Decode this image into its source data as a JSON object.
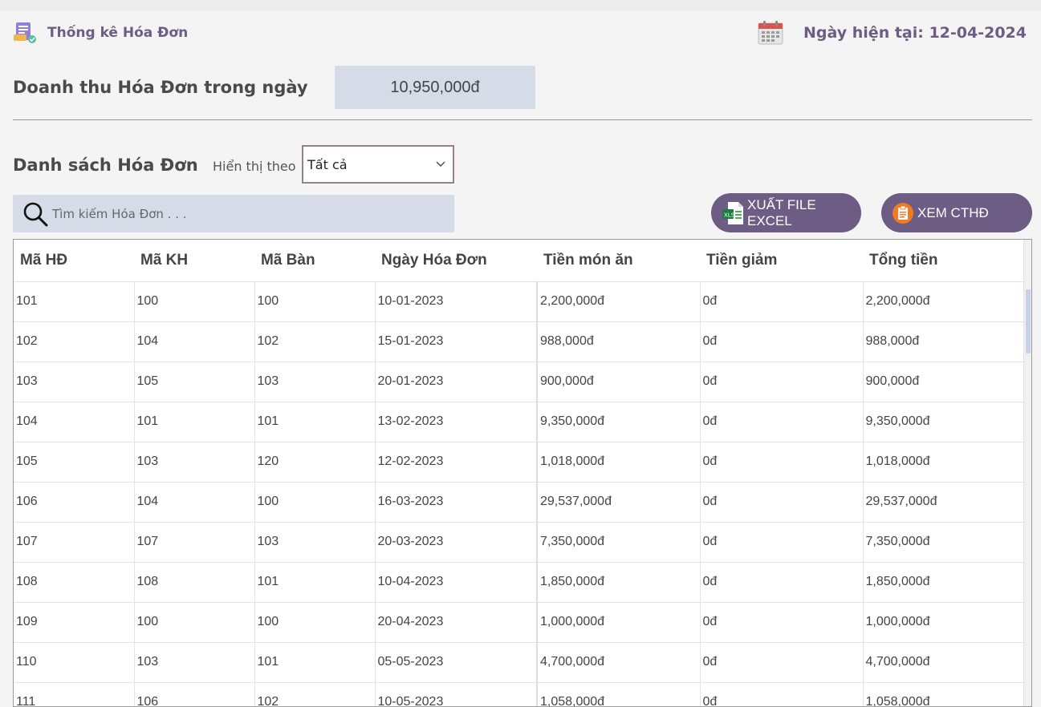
{
  "header": {
    "title": "Thống kê Hóa Đơn",
    "date_label": "Ngày hiện tại: 12-04-2024"
  },
  "revenue": {
    "label": "Doanh thu Hóa Đơn trong ngày",
    "value": "10,950,000đ"
  },
  "list": {
    "title": "Danh sách Hóa Đơn",
    "filter_label": "Hiển thị theo",
    "filter_value": "Tất cả"
  },
  "search": {
    "placeholder": "Tìm kiếm Hóa Đơn . . ."
  },
  "buttons": {
    "excel": "XUẤT FILE EXCEL",
    "cthd": "XEM CTHĐ"
  },
  "colors": {
    "accent": "#6d5c83",
    "field_bg": "#d5dbe7"
  },
  "table": {
    "columns": [
      "Mã HĐ",
      "Mã KH",
      "Mã Bàn",
      "Ngày Hóa Đơn",
      "Tiền món ăn",
      "Tiền giảm",
      "Tổng tiền"
    ],
    "rows": [
      [
        "101",
        "100",
        "100",
        "10-01-2023",
        "2,200,000đ",
        "0đ",
        "2,200,000đ"
      ],
      [
        "102",
        "104",
        "102",
        "15-01-2023",
        "988,000đ",
        "0đ",
        "988,000đ"
      ],
      [
        "103",
        "105",
        "103",
        "20-01-2023",
        "900,000đ",
        "0đ",
        "900,000đ"
      ],
      [
        "104",
        "101",
        "101",
        "13-02-2023",
        "9,350,000đ",
        "0đ",
        "9,350,000đ"
      ],
      [
        "105",
        "103",
        "120",
        "12-02-2023",
        "1,018,000đ",
        "0đ",
        "1,018,000đ"
      ],
      [
        "106",
        "104",
        "100",
        "16-03-2023",
        "29,537,000đ",
        "0đ",
        "29,537,000đ"
      ],
      [
        "107",
        "107",
        "103",
        "20-03-2023",
        "7,350,000đ",
        "0đ",
        "7,350,000đ"
      ],
      [
        "108",
        "108",
        "101",
        "10-04-2023",
        "1,850,000đ",
        "0đ",
        "1,850,000đ"
      ],
      [
        "109",
        "100",
        "100",
        "20-04-2023",
        "1,000,000đ",
        "0đ",
        "1,000,000đ"
      ],
      [
        "110",
        "103",
        "101",
        "05-05-2023",
        "4,700,000đ",
        "0đ",
        "4,700,000đ"
      ],
      [
        "111",
        "106",
        "102",
        "10-05-2023",
        "1,058,000đ",
        "0đ",
        "1,058,000đ"
      ]
    ]
  }
}
